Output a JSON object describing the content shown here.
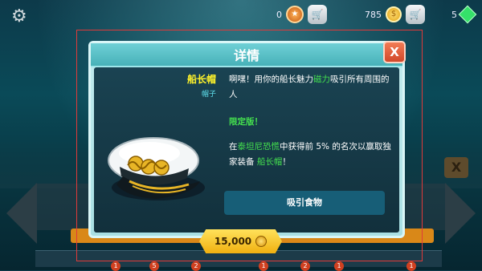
{
  "topbar": {
    "medals": "0",
    "coins": "785",
    "gems": "5"
  },
  "dialog": {
    "title": "详情",
    "close_label": "X",
    "item_name": "船长帽",
    "item_type": "帽子",
    "desc_part1": "啊嘿！用你的船长魅力",
    "desc_highlight": "磁力",
    "desc_part2": "吸引所有周围的人",
    "limited": "限定版！",
    "desc2_part1": "在",
    "desc2_highlight1": "泰坦尼恐慌",
    "desc2_part2": "中获得前 5% 的名次以赢取独家装备 ",
    "desc2_highlight2": "船长帽",
    "desc2_part3": "！",
    "action_label": "吸引食物"
  },
  "price": {
    "amount": "15,000"
  },
  "background": {
    "close_label": "X",
    "badges": [
      "1",
      "5",
      "2",
      "1",
      "2",
      "1",
      "1"
    ]
  },
  "colors": {
    "title_bar": "#47b1b8",
    "highlight_green": "#44e04e",
    "item_name_yellow": "#fff32a",
    "price_gold": "#f0b010"
  }
}
